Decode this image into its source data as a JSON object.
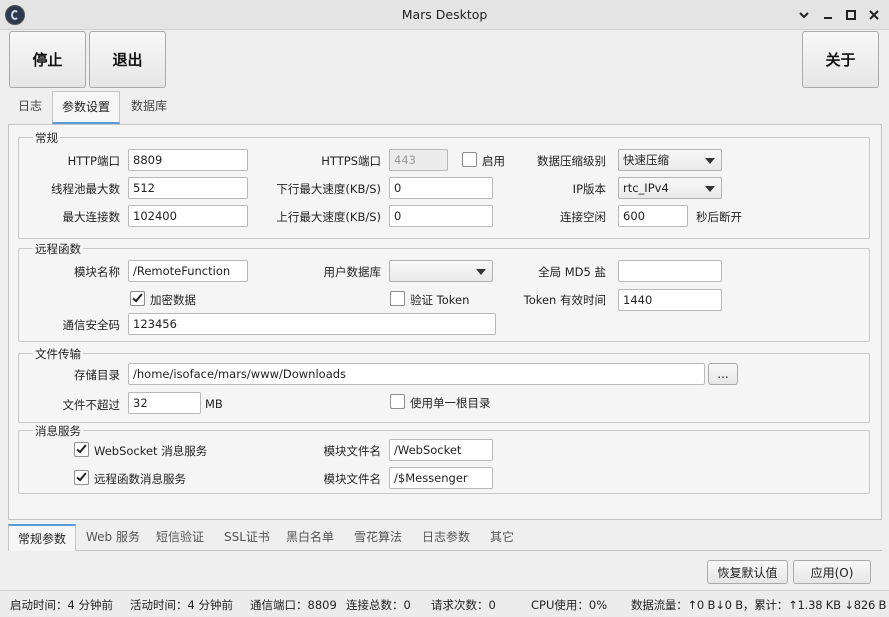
{
  "window": {
    "title": "Mars Desktop",
    "controls": [
      "chevron-down",
      "minimize",
      "maximize",
      "close"
    ]
  },
  "toolbar": {
    "stop_label": "停止",
    "exit_label": "退出",
    "about_label": "关于"
  },
  "main_tabs": [
    {
      "label": "日志",
      "active": false
    },
    {
      "label": "参数设置",
      "active": true
    },
    {
      "label": "数据库",
      "active": false
    }
  ],
  "general": {
    "title": "常规",
    "http_port_label": "HTTP端口",
    "http_port": "8809",
    "https_port_label": "HTTPS端口",
    "https_port": "443",
    "enable_label": "启用",
    "enable_checked": false,
    "compress_label": "数据压缩级别",
    "compress_value": "快速压缩",
    "threadpool_label": "线程池最大数",
    "threadpool_value": "512",
    "down_speed_label": "下行最大速度(KB/S)",
    "down_speed_value": "0",
    "ip_label": "IP版本",
    "ip_value": "rtc_IPv4",
    "max_conn_label": "最大连接数",
    "max_conn_value": "102400",
    "up_speed_label": "上行最大速度(KB/S)",
    "up_speed_value": "0",
    "idle_label": "连接空闲",
    "idle_value": "600",
    "idle_suffix": "秒后断开"
  },
  "remote": {
    "title": "远程函数",
    "module_label": "模块名称",
    "module_value": "/RemoteFunction",
    "userdb_label": "用户数据库",
    "userdb_value": "",
    "md5_label": "全局 MD5  盐",
    "md5_value": "",
    "encrypt_label": "加密数据",
    "encrypt_checked": true,
    "verify_token_label": "验证 Token",
    "verify_token_checked": false,
    "token_time_label": "Token 有效时间",
    "token_time_value": "1440",
    "security_label": "通信安全码",
    "security_value": "123456"
  },
  "file_transfer": {
    "title": "文件传输",
    "dir_label": "存储目录",
    "dir_value": "/home/isoface/mars/www/Downloads",
    "browse_label": "...",
    "max_size_label": "文件不超过",
    "max_size_value": "32",
    "max_size_unit": "MB",
    "single_root_label": "使用单一根目录",
    "single_root_checked": false
  },
  "message": {
    "title": "消息服务",
    "ws_label": "WebSocket 消息服务",
    "ws_checked": true,
    "ws_module_label": "模块文件名",
    "ws_module_value": "/WebSocket",
    "rf_label": "远程函数消息服务",
    "rf_checked": true,
    "rf_module_label": "模块文件名",
    "rf_module_value": "/$Messenger"
  },
  "bottom_tabs": [
    {
      "label": "常规参数",
      "active": true
    },
    {
      "label": "Web 服务",
      "active": false
    },
    {
      "label": "短信验证",
      "active": false
    },
    {
      "label": "SSL证书",
      "active": false
    },
    {
      "label": "黑白名单",
      "active": false
    },
    {
      "label": "雪花算法",
      "active": false
    },
    {
      "label": "日志参数",
      "active": false
    },
    {
      "label": "其它",
      "active": false
    }
  ],
  "actions": {
    "restore_label": "恢复默认值",
    "apply_label": "应用(O)"
  },
  "status": {
    "start_time": "启动时间：4 分钟前",
    "active_time": "活动时间：4 分钟前",
    "port": "通信端口：8809",
    "connections": "连接总数：0",
    "requests": "请求次数：0",
    "cpu": "CPU使用：0%",
    "traffic": "数据流量：↑0 B↓0 B，累计：↑1.38 KB ↓826 B"
  }
}
